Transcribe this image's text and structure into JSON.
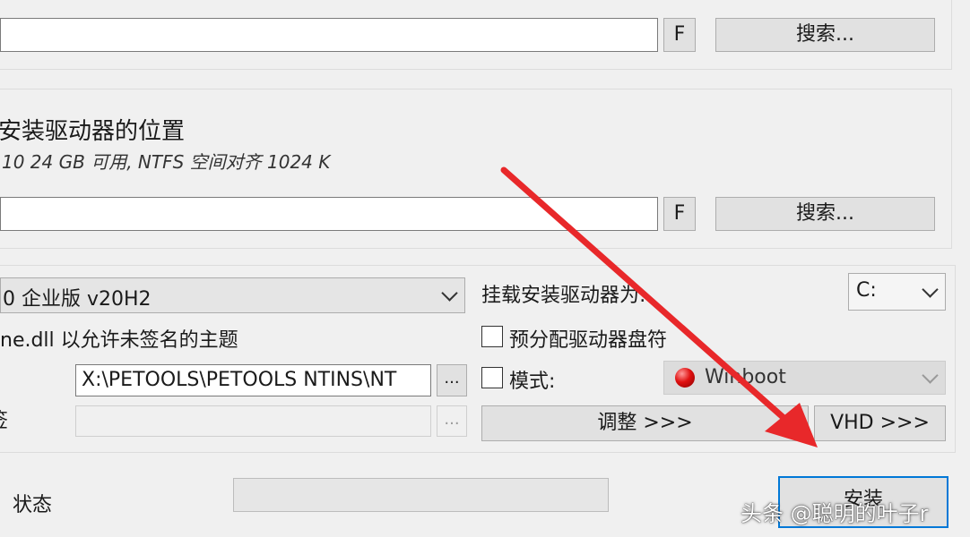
{
  "top_path": {
    "value": "",
    "f_button": "F",
    "browse_button": "搜索..."
  },
  "install_location": {
    "title": "安装驱动器的位置",
    "info": "10 24 GB 可用, NTFS 空间对齐 1024 K",
    "value": "",
    "f_button": "F",
    "browse_button": "搜索..."
  },
  "options": {
    "edition_select": "0 企业版 v20H2",
    "theme_checkbox_label": "ne.dll 以允许未签名的主题",
    "path_value": "X:\\PETOOLS\\PETOOLS NTINS\\NT",
    "path_browse_button": "...",
    "unattended_partial_label": "签",
    "unattended_value": "",
    "unattended_browse_button": "...",
    "mount_label": "挂载安装驱动器为:",
    "drive_letter": "C:",
    "prealloc_label": "预分配驱动器盘符",
    "mode_label": "模式:",
    "mode_value": "Winboot",
    "tweak_button": "调整 >>>",
    "vhd_button": "VHD >>>"
  },
  "status": {
    "label": "状态",
    "progress": 0,
    "install_button": "安装"
  },
  "watermark": "头条 @聪明的叶子r",
  "colors": {
    "accent": "#0078d7",
    "arrow": "#e8282a",
    "mode_indicator": "#e01010"
  }
}
